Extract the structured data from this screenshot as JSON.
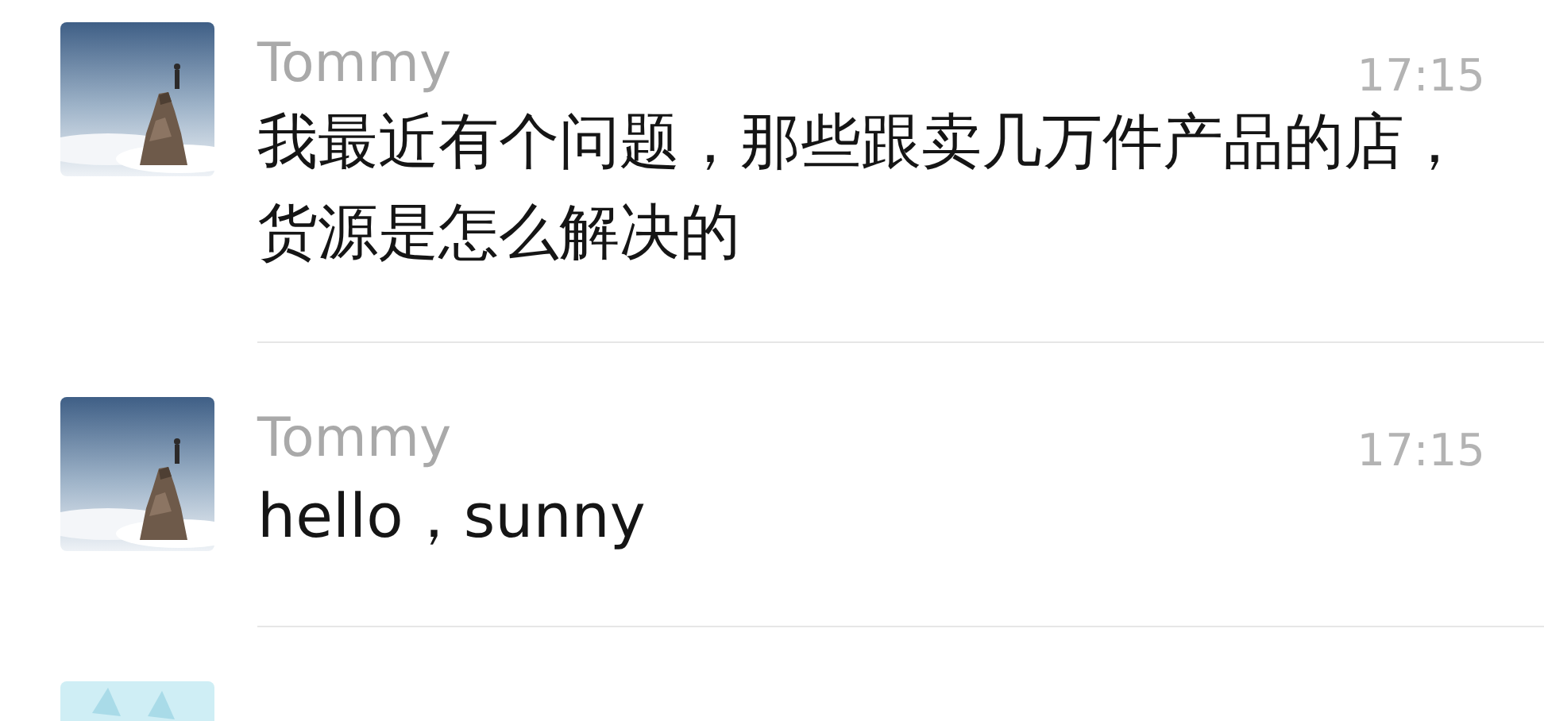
{
  "conversations": [
    {
      "name": "Tommy",
      "time": "17:15",
      "message": "我最近有个问题，那些跟卖几万件产品的店，货源是怎么解决的"
    },
    {
      "name": "Tommy",
      "time": "17:15",
      "message": "hello，sunny"
    },
    {
      "avatar": {
        "kind": "sketch"
      }
    }
  ]
}
